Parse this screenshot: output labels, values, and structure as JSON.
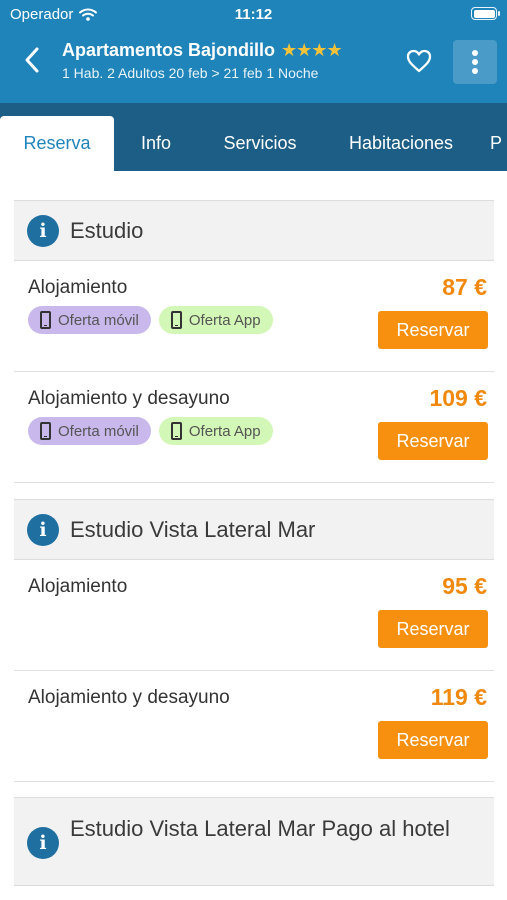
{
  "status_bar": {
    "carrier": "Operador",
    "time": "11:12"
  },
  "header": {
    "hotel_name": "Apartamentos Bajondillo",
    "stars": "★★★★",
    "subtitle": "1 Hab. 2 Adultos 20 feb > 21 feb 1 Noche",
    "icons": [
      "chevron-left-icon",
      "heart-icon",
      "more-vertical-icon"
    ]
  },
  "tabs": [
    {
      "label": "Reserva",
      "active": true
    },
    {
      "label": "Info",
      "active": false
    },
    {
      "label": "Servicios",
      "active": false
    },
    {
      "label": "Habitaciones",
      "active": false
    },
    {
      "label": "P",
      "active": false
    }
  ],
  "badges": {
    "movil": "Oferta móvil",
    "app": "Oferta App"
  },
  "reserve_label": "Reservar",
  "rooms": [
    {
      "name": "Estudio",
      "rates": [
        {
          "name": "Alojamiento",
          "price": "87 €"
        },
        {
          "name": "Alojamiento y desayuno",
          "price": "109 €"
        }
      ]
    },
    {
      "name": "Estudio Vista Lateral Mar",
      "rates": [
        {
          "name": "Alojamiento",
          "price": "95 €"
        },
        {
          "name": "Alojamiento y desayuno",
          "price": "119 €"
        }
      ]
    },
    {
      "name": "Estudio Vista Lateral Mar Pago al hotel",
      "rates": []
    }
  ],
  "colors": {
    "header": "#1f84b9",
    "tabs": "#1c5e86",
    "price": "#f0890d",
    "button": "#f7900f",
    "badge_movil": "#c9b8ec",
    "badge_app": "#d3f7b6"
  }
}
